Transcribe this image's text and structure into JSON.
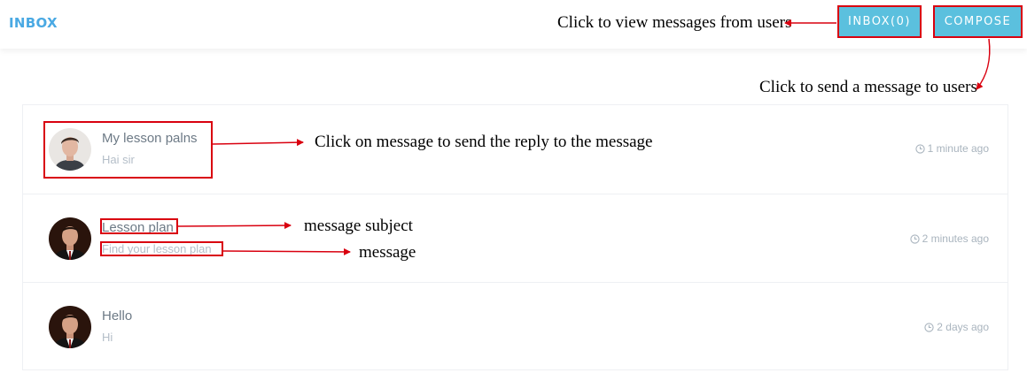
{
  "header": {
    "title": "INBOX"
  },
  "toolbar": {
    "inbox_label": "INBOX(0)",
    "compose_label": "COMPOSE"
  },
  "annotations": {
    "inbox_note": "Click to view messages from users",
    "compose_note": "Click to send a message to users",
    "reply_note": "Click on message to send the reply to the message",
    "subject_note": "message subject",
    "message_note": "message"
  },
  "messages": [
    {
      "subject": "My lesson palns",
      "preview": "Hai sir",
      "time": "1 minute ago",
      "avatar": "avatar-light"
    },
    {
      "subject": "Lesson plan",
      "preview": "Find your lesson plan",
      "time": "2 minutes ago",
      "avatar": "avatar-dark"
    },
    {
      "subject": "Hello",
      "preview": "Hi",
      "time": "2 days ago",
      "avatar": "avatar-dark"
    }
  ],
  "colors": {
    "brand": "#4aa9e3",
    "button": "#5bc0de",
    "annotation": "#d9000f"
  }
}
